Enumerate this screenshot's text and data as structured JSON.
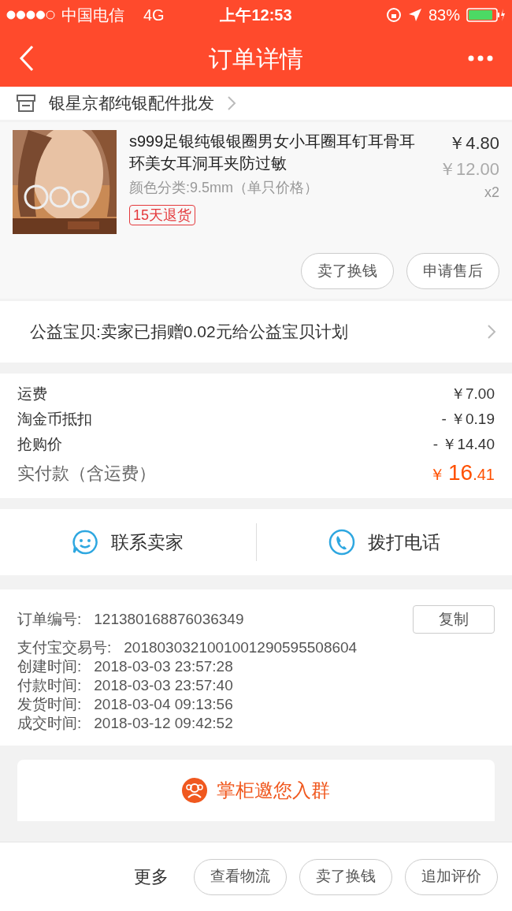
{
  "status_bar": {
    "carrier": "中国电信",
    "network": "4G",
    "time": "上午12:53",
    "battery": "83%"
  },
  "nav": {
    "title": "订单详情"
  },
  "shop": {
    "name": "银星京都纯银配件批发"
  },
  "product": {
    "kind": "picture",
    "title": "s999足银纯银银圈男女小耳圈耳钉耳骨耳环美女耳洞耳夹防过敏",
    "sku": "颜色分类:9.5mm（单只价格）",
    "tag": "15天退货",
    "price": "￥4.80",
    "original_price": "￥12.00",
    "quantity": "x2",
    "buttons": [
      "卖了换钱",
      "申请售后"
    ]
  },
  "charity": {
    "text": "公益宝贝:卖家已捐赠0.02元给公益宝贝计划"
  },
  "costs": [
    {
      "label": "运费",
      "value": "￥7.00"
    },
    {
      "label": "淘金币抵扣",
      "value": "- ￥0.19"
    },
    {
      "label": "抢购价",
      "value": "- ￥14.40"
    }
  ],
  "total": {
    "label": "实付款（含运费）",
    "currency": "￥",
    "integer": "16",
    "decimal": ".41"
  },
  "contact": [
    {
      "kind": "chat",
      "label": "联系卖家"
    },
    {
      "kind": "phone",
      "label": "拨打电话"
    }
  ],
  "order_info": {
    "copy_button": "复制",
    "rows": [
      {
        "label": "订单编号:",
        "value": "121380168876036349"
      },
      {
        "label": "支付宝交易号:",
        "value": "2018030321001001290595508604"
      },
      {
        "label": "创建时间:",
        "value": "2018-03-03 23:57:28"
      },
      {
        "label": "付款时间:",
        "value": "2018-03-03 23:57:40"
      },
      {
        "label": "发货时间:",
        "value": "2018-03-04 09:13:56"
      },
      {
        "label": "成交时间:",
        "value": "2018-03-12 09:42:52"
      }
    ]
  },
  "group_invite": {
    "text": "掌柜邀您入群"
  },
  "bottom_bar": {
    "more": "更多",
    "buttons": [
      "查看物流",
      "卖了换钱",
      "追加评价"
    ]
  }
}
